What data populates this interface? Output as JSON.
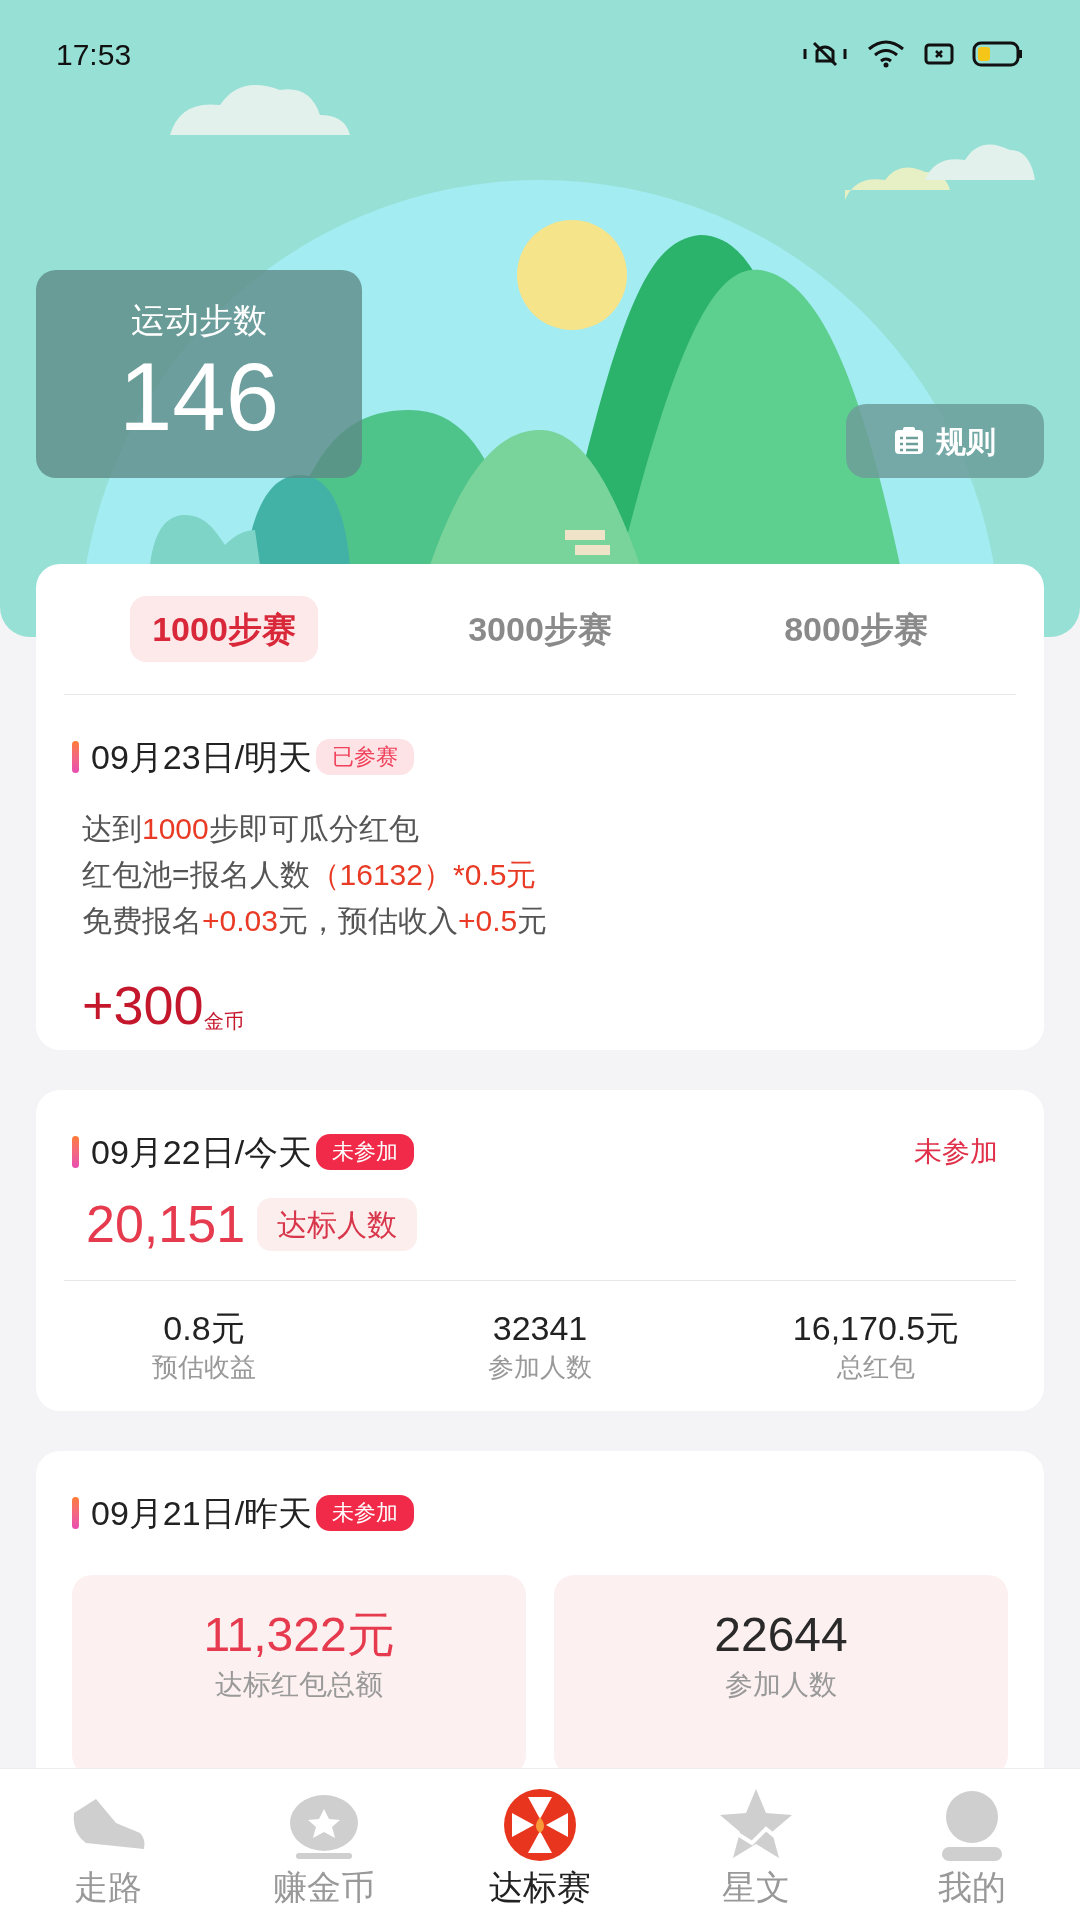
{
  "status_bar": {
    "time": "17:53"
  },
  "steps": {
    "label": "运动步数",
    "value": "146"
  },
  "rules_button": {
    "label": "规则"
  },
  "tabs": [
    {
      "label": "1000步赛",
      "selected": true
    },
    {
      "label": "3000步赛",
      "selected": false
    },
    {
      "label": "8000步赛",
      "selected": false
    }
  ],
  "races": [
    {
      "kind": "upcoming",
      "date": "09月23日/明天",
      "badge": {
        "label": "已参赛",
        "kind": "soft"
      },
      "lines": [
        [
          {
            "text": "达到",
            "highlight": false
          },
          {
            "text": "1000",
            "highlight": true
          },
          {
            "text": "步即可瓜分红包",
            "highlight": false
          }
        ],
        [
          {
            "text": "红包池=报名人数",
            "highlight": false
          },
          {
            "text": "（16132）*0.5元",
            "highlight": true
          }
        ],
        [
          {
            "text": "免费报名",
            "highlight": false
          },
          {
            "text": "+0.03",
            "highlight": true
          },
          {
            "text": "元，预估收入",
            "highlight": false
          },
          {
            "text": "+0.5",
            "highlight": true
          },
          {
            "text": "元",
            "highlight": false
          }
        ]
      ],
      "reward": "+300",
      "reward_unit": "金币"
    },
    {
      "kind": "today",
      "date": "09月22日/今天",
      "badge": {
        "label": "未参加",
        "kind": "solid"
      },
      "status": "未参加",
      "count": "20,151",
      "count_label": "达标人数",
      "stats": [
        {
          "value": "0.8元",
          "label": "预估收益"
        },
        {
          "value": "32341",
          "label": "参加人数"
        },
        {
          "value": "16,170.5元",
          "label": "总红包"
        }
      ]
    },
    {
      "kind": "past",
      "date": "09月21日/昨天",
      "badge": {
        "label": "未参加",
        "kind": "solid"
      },
      "boxes": [
        {
          "value": "11,322元",
          "label": "达标红包总额",
          "highlight": true
        },
        {
          "value": "22644",
          "label": "参加人数",
          "highlight": false
        }
      ]
    }
  ],
  "nav": [
    {
      "label": "走路",
      "selected": false
    },
    {
      "label": "赚金币",
      "selected": false
    },
    {
      "label": "达标赛",
      "selected": true
    },
    {
      "label": "星文",
      "selected": false
    },
    {
      "label": "我的",
      "selected": false
    }
  ]
}
